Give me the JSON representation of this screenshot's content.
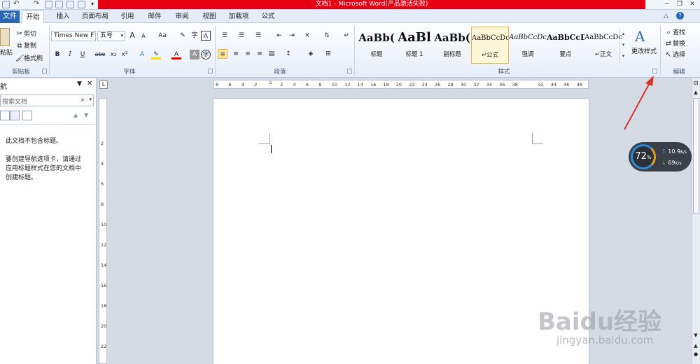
{
  "window": {
    "title": "文档1 - Microsoft Word(产品激活失败)"
  },
  "tabs": {
    "file": "文件",
    "items": [
      "开始",
      "插入",
      "页面布局",
      "引用",
      "邮件",
      "审阅",
      "视图",
      "加载项",
      "公式"
    ],
    "active_index": 0
  },
  "clipboard": {
    "paste": "粘贴",
    "cut": "剪切",
    "copy": "复制",
    "format_painter": "格式刷",
    "group_label": "剪贴板"
  },
  "font": {
    "name_value": "Times New F",
    "size_value": "五号",
    "aa_label": "Aa",
    "grow_label": "A",
    "shrink_label": "A",
    "group_label": "字体",
    "bold": "B",
    "italic": "I",
    "underline": "U",
    "strike": "abe",
    "subscript": "x₂",
    "superscript": "x²",
    "font_color": "A"
  },
  "paragraph": {
    "group_label": "段落"
  },
  "styles": {
    "group_label": "样式",
    "items": [
      {
        "preview": "AaBb(",
        "label": "标题"
      },
      {
        "preview": "AaBl",
        "label": "标题 1"
      },
      {
        "preview": "AaBb(",
        "label": "副标题"
      },
      {
        "preview": "AaBbCcDc",
        "label": "↵公式"
      },
      {
        "preview": "AaBbCcDc",
        "label": "强调"
      },
      {
        "preview": "AaBbCcD",
        "label": "要点"
      },
      {
        "preview": "AaBbCcDc",
        "label": "↵正文"
      }
    ],
    "active_index": 3,
    "change_styles": "更改样式"
  },
  "editing": {
    "find": "查找",
    "replace": "替换",
    "select": "选择",
    "group_label": "编辑"
  },
  "nav_pane": {
    "title": "航",
    "search_placeholder": "搜索文档",
    "empty_line1": "此文档不包含标题。",
    "empty_line2": "要创建导航选项卡，请通过",
    "empty_line3": "应用标题样式在您的文档中",
    "empty_line4": "创建标题。"
  },
  "ruler": {
    "h_numbers": [
      "8",
      "6",
      "4",
      "2",
      "",
      "2",
      "4",
      "6",
      "8",
      "10",
      "12",
      "14",
      "16",
      "18",
      "20",
      "22",
      "24",
      "26",
      "28",
      "30",
      "32",
      "34",
      "36",
      "38",
      "",
      "42",
      "44",
      "46",
      "48"
    ],
    "v_numbers": [
      "2",
      "4",
      "6",
      "8",
      "10",
      "12",
      "14",
      "16",
      "18",
      "20",
      "22"
    ]
  },
  "speed_widget": {
    "percent": "72",
    "percent_unit": "%",
    "upload": "10.9",
    "upload_unit": "K/s",
    "download": "69",
    "download_unit": "K/s"
  },
  "watermark": {
    "brand": "Baidu经验",
    "url": "jingyan.baidu.com"
  },
  "colors": {
    "titlebar_red": "#e60012",
    "file_tab_blue": "#2a66b8",
    "arrow_red": "#e0302a",
    "active_style": "#e6b448"
  }
}
